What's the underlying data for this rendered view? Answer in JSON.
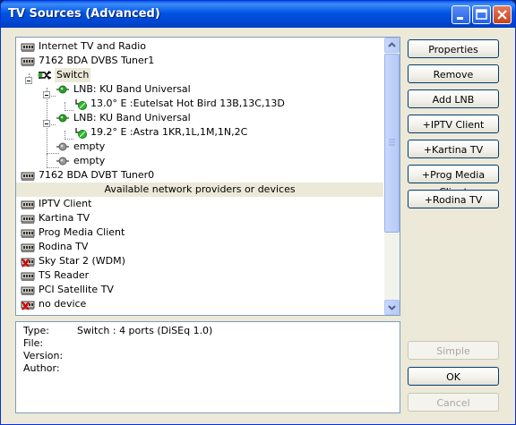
{
  "window": {
    "title": "TV Sources (Advanced)"
  },
  "colors": {
    "titlebar": "#0054e3",
    "accent": "#316ac5",
    "window_bg": "#ece9d8"
  },
  "tree": {
    "rows": [
      {
        "label": "Internet TV and Radio",
        "icon": "tuner-card-icon"
      },
      {
        "label": "7162 BDA DVBS Tuner1",
        "icon": "tuner-card-icon"
      },
      {
        "label": "Switch",
        "icon": "switch-icon"
      },
      {
        "label": "LNB: KU Band Universal",
        "icon": "lnb-icon"
      },
      {
        "label": "13.0° E :Eutelsat Hot Bird 13B,13C,13D",
        "icon": "satellite-icon"
      },
      {
        "label": "LNB: KU Band Universal",
        "icon": "lnb-icon"
      },
      {
        "label": "19.2° E :Astra 1KR,1L,1M,1N,2C",
        "icon": "satellite-icon"
      },
      {
        "label": "empty",
        "icon": "empty-lnb-icon"
      },
      {
        "label": "empty",
        "icon": "empty-lnb-icon"
      },
      {
        "label": "7162 BDA DVBT Tuner0",
        "icon": "tuner-card-icon"
      }
    ],
    "providers_header": "Available network providers or devices",
    "providers": [
      {
        "label": "IPTV Client",
        "icon": "tuner-card-icon"
      },
      {
        "label": "Kartina TV",
        "icon": "tuner-card-icon"
      },
      {
        "label": "Prog Media Client",
        "icon": "tuner-card-icon"
      },
      {
        "label": "Rodina TV",
        "icon": "tuner-card-icon"
      },
      {
        "label": "Sky Star 2 (WDM)",
        "icon": "tuner-card-unavailable-icon"
      },
      {
        "label": "TS Reader",
        "icon": "tuner-card-icon"
      },
      {
        "label": "PCI Satellite TV",
        "icon": "tuner-card-icon"
      },
      {
        "label": "no device",
        "icon": "tuner-card-unavailable-icon"
      }
    ]
  },
  "info": {
    "type_label": "Type:",
    "type_value": "Switch : 4 ports (DiSEq 1.0)",
    "file_label": "File:",
    "file_value": "",
    "version_label": "Version:",
    "version_value": "",
    "author_label": "Author:",
    "author_value": ""
  },
  "buttons": {
    "properties": "Properties",
    "remove": "Remove",
    "add_lnb": "Add LNB",
    "iptv_client": "+IPTV Client",
    "kartina_tv": "+Kartina TV",
    "prog_media_client": "+Prog Media Client",
    "rodina_tv": "+Rodina TV",
    "simple": "Simple",
    "ok": "OK",
    "cancel": "Cancel"
  }
}
